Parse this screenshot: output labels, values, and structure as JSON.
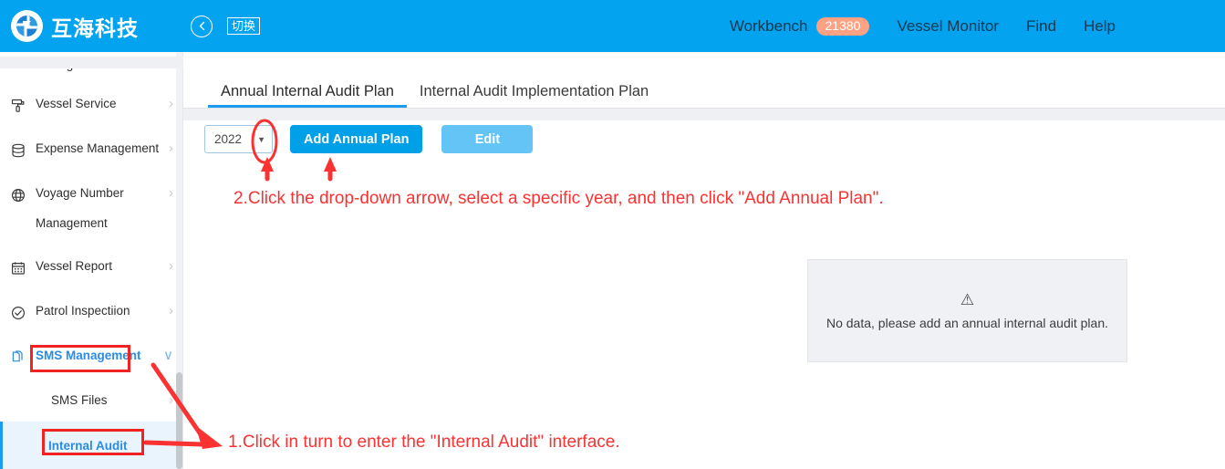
{
  "header": {
    "logo_text": "互海科技",
    "back_icon": "back-arrow-icon",
    "switch_badge": "切换",
    "nav": {
      "workbench": "Workbench",
      "workbench_count": "21380",
      "vessel_monitor": "Vessel Monitor",
      "find": "Find",
      "help": "Help"
    },
    "bg_color": "#03a3ef",
    "badge_color": "#ffa183"
  },
  "sidebar": {
    "items": [
      {
        "label": "Management",
        "icon": "none",
        "chevron": ""
      },
      {
        "label": "Vessel Service",
        "icon": "paint-roller-icon",
        "chevron": "›"
      },
      {
        "label": "Expense Management",
        "icon": "database-icon",
        "chevron": "›"
      },
      {
        "label": "Voyage Number",
        "icon": "globe-icon",
        "chevron": "›"
      },
      {
        "label": "Management",
        "icon": "none",
        "chevron": ""
      },
      {
        "label": "Vessel Report",
        "icon": "calendar-icon",
        "chevron": "›"
      },
      {
        "label": "Patrol Inspectiion",
        "icon": "check-circle-icon",
        "chevron": "›"
      },
      {
        "label": "SMS Management",
        "icon": "documents-icon",
        "chevron": "∨"
      },
      {
        "label": "SMS Files",
        "icon": "none",
        "chevron": "›"
      },
      {
        "label": "Internal Audit",
        "icon": "none",
        "chevron": ""
      }
    ],
    "active_item": "Internal Audit",
    "highlight_color": "#2b8ce0",
    "active_bg": "#eaf4fd"
  },
  "main": {
    "tabs": [
      {
        "label": "Annual Internal Audit Plan",
        "active": true
      },
      {
        "label": "Internal Audit Implementation Plan",
        "active": false
      }
    ],
    "toolbar": {
      "year_value": "2022",
      "caret_icon": "chevron-down-icon",
      "add_plan_label": "Add Annual Plan",
      "edit_label": "Edit",
      "add_plan_color": "#00a0e9",
      "edit_color": "#63c4f5"
    },
    "empty_state": {
      "icon": "warning-triangle-icon",
      "message": "No data, please add an annual internal audit plan."
    }
  },
  "annotations": {
    "color": "#fa3232",
    "step1": "1.Click in turn to enter the \"Internal Audit\" interface.",
    "step2": "2.Click the drop-down arrow, select a specific year, and then click \"Add Annual Plan\"."
  }
}
